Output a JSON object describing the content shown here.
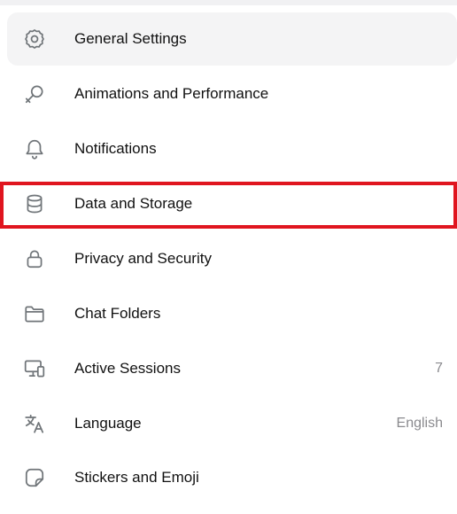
{
  "settings_menu": {
    "items": [
      {
        "label": "General Settings",
        "icon": "gear-icon",
        "value": ""
      },
      {
        "label": "Animations and Performance",
        "icon": "magic-wand-icon",
        "value": ""
      },
      {
        "label": "Notifications",
        "icon": "bell-icon",
        "value": ""
      },
      {
        "label": "Data and Storage",
        "icon": "database-icon",
        "value": ""
      },
      {
        "label": "Privacy and Security",
        "icon": "lock-icon",
        "value": ""
      },
      {
        "label": "Chat Folders",
        "icon": "folder-icon",
        "value": ""
      },
      {
        "label": "Active Sessions",
        "icon": "devices-icon",
        "value": "7"
      },
      {
        "label": "Language",
        "icon": "translate-icon",
        "value": "English"
      },
      {
        "label": "Stickers and Emoji",
        "icon": "sticker-icon",
        "value": ""
      }
    ],
    "active_item": "General Settings",
    "highlighted_item": "Data and Storage"
  },
  "colors": {
    "highlight_border": "#e0151f",
    "active_background": "#f4f4f5",
    "icon_color": "#707579",
    "label_color": "#111111",
    "value_color": "#8a8a8e"
  }
}
